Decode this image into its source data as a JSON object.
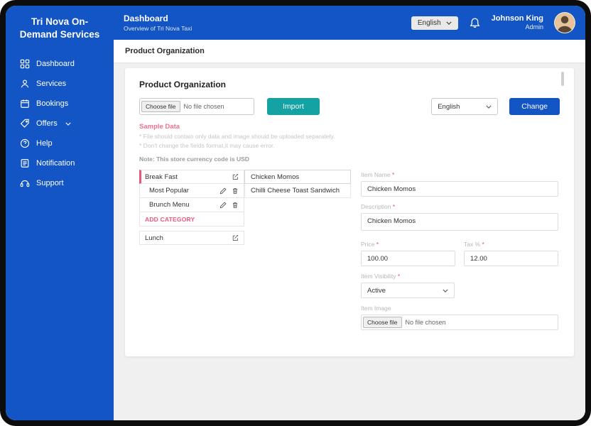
{
  "colors": {
    "primary_blue": "#1355c4",
    "teal": "#14a2a2",
    "accent_pink": "#e9587c"
  },
  "sidebar": {
    "title": "Tri Nova On-Demand Services",
    "items": [
      {
        "label": "Dashboard",
        "icon": "dashboard-icon"
      },
      {
        "label": "Services",
        "icon": "services-icon"
      },
      {
        "label": "Bookings",
        "icon": "bookings-icon"
      },
      {
        "label": "Offers",
        "icon": "offers-icon",
        "has_chevron": true
      },
      {
        "label": "Help",
        "icon": "help-icon"
      },
      {
        "label": "Notification",
        "icon": "notification-icon"
      },
      {
        "label": "Support",
        "icon": "support-icon"
      }
    ]
  },
  "header": {
    "title": "Dashboard",
    "subtitle": "Overview of Tri Nova Taxi",
    "language_label": "English",
    "user": {
      "name": "Johnson King",
      "role": "Admin"
    }
  },
  "breadcrumb": {
    "title": "Product Organization"
  },
  "card": {
    "title": "Product Organization",
    "upload": {
      "choose_file_label": "Choose file",
      "no_file_text": "No file chosen"
    },
    "import_button": "Import",
    "language_select_value": "English",
    "change_button": "Change",
    "sample_data_label": "Sample Data",
    "hint1": "* File should contain only data and image should be uploaded separately.",
    "hint2": "* Don't change the fields format,it may cause error.",
    "note": "Note: This store currency code is USD",
    "categories": [
      {
        "label": "Break Fast"
      },
      {
        "label": "Most Popular"
      },
      {
        "label": "Brunch Menu"
      },
      {
        "label": "ADD CATEGORY"
      },
      {
        "label": "Lunch"
      }
    ],
    "items": [
      {
        "label": "Chicken Momos"
      },
      {
        "label": "Chilli Cheese Toast Sandwich"
      }
    ],
    "form": {
      "required_mark": "*",
      "item_name_label": "Item Name",
      "item_name_value": "Chicken Momos",
      "description_label": "Description",
      "description_value": "Chicken Momos",
      "price_label": "Price",
      "price_value": "100.00",
      "tax_label": "Tax %",
      "tax_value": "12.00",
      "visibility_label": "Item Visibility",
      "visibility_value": "Active",
      "image_label": "Item Image",
      "image_choose_label": "Choose file",
      "image_no_file_text": "No file chosen"
    }
  }
}
